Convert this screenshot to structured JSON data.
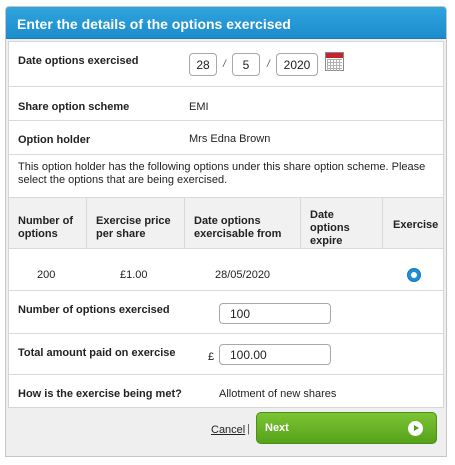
{
  "dialog": {
    "title": "Enter the details of the options exercised"
  },
  "date_exercised": {
    "label": "Date options exercised",
    "day": "28",
    "month": "5",
    "year": "2020",
    "separator": "/",
    "icon": "calendar-icon"
  },
  "scheme": {
    "label": "Share option scheme",
    "value": "EMI"
  },
  "holder": {
    "label": "Option holder",
    "value": "Mrs Edna Brown"
  },
  "info_text": "This option holder has the following options under this share option scheme. Please select the options that are being exercised.",
  "table": {
    "headers": {
      "number": "Number of options",
      "price": "Exercise price per share",
      "from": "Date options exercisable from",
      "expire": "Date options expire",
      "exercise": "Exercise"
    },
    "rows": [
      {
        "number": "200",
        "price": "£1.00",
        "from": "28/05/2020",
        "expire": "",
        "selected": true
      }
    ]
  },
  "num_exercised": {
    "label": "Number of options exercised",
    "value": "100"
  },
  "total_paid": {
    "label": "Total amount paid on exercise",
    "currency": "£",
    "value": "100.00"
  },
  "exercise_met": {
    "label": "How is the exercise being met?",
    "value": "Allotment of new shares"
  },
  "footer": {
    "cancel_label": "Cancel",
    "pipe": "|",
    "next_label": "Next"
  },
  "colors": {
    "header_blue": "#1d8ccd",
    "next_green": "#5fae22",
    "radio_blue": "#1e8fd6"
  }
}
